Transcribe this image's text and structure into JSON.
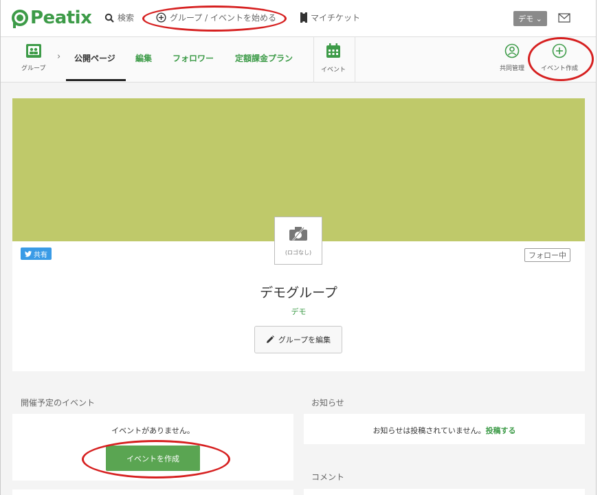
{
  "header": {
    "logo_text": "Peatix",
    "search_label": "検索",
    "start_label": "グループ / イベントを始める",
    "tickets_label": "マイチケット",
    "user_menu_label": "デモ ⌄"
  },
  "subnav": {
    "group_icon_label": "グループ",
    "tabs": [
      {
        "label": "公開ページ"
      },
      {
        "label": "編集"
      },
      {
        "label": "フォロワー"
      },
      {
        "label": "定額課金プラン"
      }
    ],
    "event_icon_label": "イベント",
    "co_manage_label": "共同管理",
    "create_event_label": "イベント作成"
  },
  "group": {
    "share_label": "共有",
    "follow_label": "フォロー中",
    "no_logo_label": "(ロゴなし)",
    "name": "デモグループ",
    "owner": "デモ",
    "edit_label": "グループを編集"
  },
  "events_section": {
    "title": "開催予定のイベント",
    "empty_text": "イベントがありません。",
    "create_button": "イベントを作成"
  },
  "news_section": {
    "title": "お知らせ",
    "empty_text": "お知らせは投稿されていません。",
    "post_link": "投稿する"
  },
  "comments_section": {
    "title": "コメント"
  },
  "colors": {
    "brand_green": "#3d9b48",
    "banner": "#bfc96a",
    "annotation_red": "#d62020",
    "share_blue": "#3a9be6"
  }
}
